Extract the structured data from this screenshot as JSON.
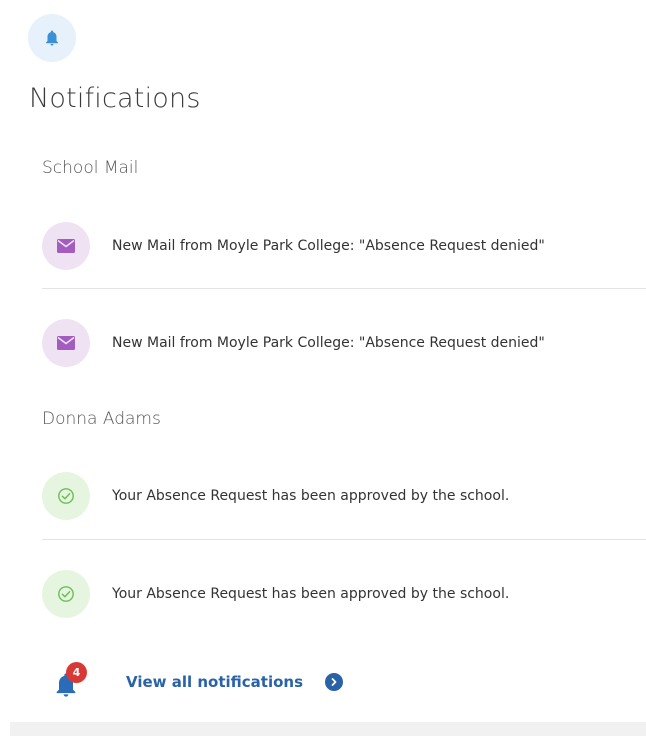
{
  "header": {
    "icon": "bell-icon",
    "title": "Notifications"
  },
  "groups": [
    {
      "label": "School Mail",
      "items": [
        {
          "icon": "envelope-icon",
          "text": "New Mail from Moyle Park College: \"Absence Request denied\""
        },
        {
          "icon": "envelope-icon",
          "text": "New Mail from Moyle Park College: \"Absence Request denied\""
        }
      ]
    },
    {
      "label": "Donna Adams",
      "items": [
        {
          "icon": "check-circle-icon",
          "text": "Your Absence Request has been approved by the school."
        },
        {
          "icon": "check-circle-icon",
          "text": "Your Absence Request has been approved by the school."
        }
      ]
    }
  ],
  "footer": {
    "icon": "bell-icon",
    "badge_count": "4",
    "link_label": "View all notifications",
    "chevron_icon": "chevron-right-icon"
  },
  "colors": {
    "accent": "#2a62a8",
    "badge": "#d73a36",
    "mail_icon": "#a35cc0",
    "check_icon": "#6fbf5a",
    "bell": "#2b6cb8"
  }
}
